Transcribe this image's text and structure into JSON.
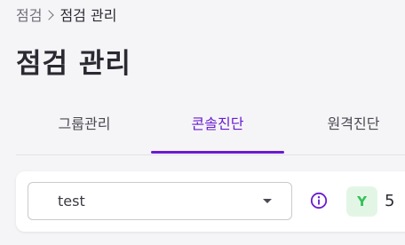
{
  "breadcrumb": {
    "root": "점검",
    "current": "점검 관리"
  },
  "page": {
    "title": "점검 관리"
  },
  "tabs": [
    {
      "label": "그룹관리",
      "active": false
    },
    {
      "label": "콘솔진단",
      "active": true
    },
    {
      "label": "원격진단",
      "active": false
    }
  ],
  "filter": {
    "selected_value": "test"
  },
  "status": {
    "badge": "Y",
    "count": "5"
  },
  "colors": {
    "accent": "#6a1bd1",
    "badge_bg": "#e3f6e5",
    "badge_text": "#34c15a"
  },
  "icons": {
    "info": "info-icon",
    "dropdown": "chevron-down-icon",
    "separator": "chevron-right-icon"
  }
}
